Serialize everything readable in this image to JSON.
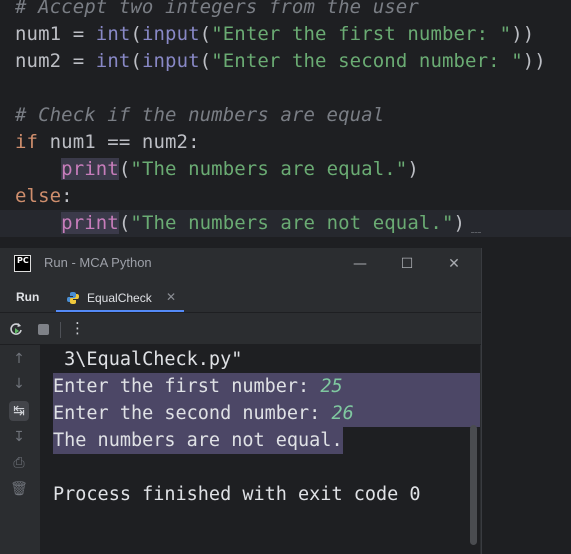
{
  "editor": {
    "comment1": "# Accept two integers from the user",
    "line_num1": {
      "var": "num1",
      "op": " = ",
      "int": "int",
      "p1": "(",
      "input": "input",
      "p2": "(",
      "str": "\"Enter the first number: \"",
      "close": "))"
    },
    "line_num2": {
      "var": "num2",
      "op": " = ",
      "int": "int",
      "p1": "(",
      "input": "input",
      "p2": "(",
      "str": "\"Enter the second number: \"",
      "close": "))"
    },
    "comment2": "# Check if the numbers are equal",
    "if_line": {
      "kw": "if",
      "rest": " num1 == num2:"
    },
    "print1": {
      "indent": "    ",
      "fn": "print",
      "open": "(",
      "str": "\"The numbers are equal.\"",
      "close": ")"
    },
    "else_line": {
      "kw": "else",
      "rest": ":"
    },
    "print2": {
      "indent": "    ",
      "fn": "print",
      "open": "(",
      "str": "\"The numbers are not equal.\"",
      "close": ")"
    }
  },
  "run_window": {
    "title": "Run - MCA Python",
    "logo": "PC",
    "tab_run": "Run",
    "tab_config": "EqualCheck",
    "icons": [
      "rerun-icon",
      "stop-icon",
      "more-icon",
      "up-arrow-icon",
      "down-arrow-icon",
      "soft-wrap-icon",
      "scroll-to-end-icon",
      "print-icon",
      "trash-icon"
    ]
  },
  "console": {
    "path_line": " 3\\EqualCheck.py\"",
    "prompt1": "Enter the first number: ",
    "value1": "25",
    "prompt2": "Enter the second number: ",
    "value2": "26",
    "result": "The numbers are not equal.",
    "finished": "Process finished with exit code 0"
  },
  "colors": {
    "editor_bg": "#1e1f22",
    "keyword": "#cf8e6d",
    "string": "#6aab73",
    "builtin": "#8888c6",
    "comment": "#7a7e85",
    "selection": "#4c4766",
    "accent": "#548af7"
  }
}
